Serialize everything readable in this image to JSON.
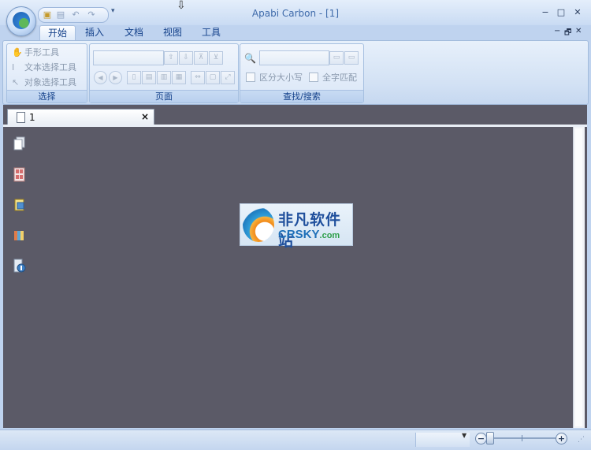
{
  "window": {
    "title": "Apabi Carbon - [1]",
    "minimize_glyph": "−",
    "maximize_glyph": "□",
    "close_glyph": "✕"
  },
  "quick_access": {
    "icons": [
      "open-folder-icon",
      "save-icon",
      "undo-icon",
      "redo-icon"
    ],
    "dropdown_glyph": "▾"
  },
  "ribbon": {
    "tabs": [
      {
        "label": "开始",
        "active": true
      },
      {
        "label": "插入",
        "active": false
      },
      {
        "label": "文档",
        "active": false
      },
      {
        "label": "视图",
        "active": false
      },
      {
        "label": "工具",
        "active": false
      }
    ],
    "mdi_controls": {
      "minimize": "−",
      "restore": "🗗",
      "close": "✕"
    },
    "groups": {
      "select": {
        "label": "选择",
        "tools": [
          "手形工具",
          "文本选择工具",
          "对象选择工具"
        ]
      },
      "page": {
        "label": "页面"
      },
      "find": {
        "label": "查找/搜索",
        "case_sensitive": "区分大小写",
        "whole_word": "全字匹配"
      }
    }
  },
  "document_tab": {
    "label": "1",
    "close": "×"
  },
  "side_panel_icons": [
    "pages-icon",
    "thumbnails-icon",
    "attachments-icon",
    "bookmarks-icon",
    "properties-icon"
  ],
  "watermark": {
    "cn": "非凡软件站",
    "en_main": "CRSKY",
    "en_suffix": ".com"
  },
  "statusbar": {
    "zoom_minus": "−",
    "zoom_plus": "+",
    "grip": "⋰"
  },
  "colors": {
    "accent": "#15428b",
    "canvas": "#5b5a67",
    "ribbon": "#d2e1f4"
  }
}
